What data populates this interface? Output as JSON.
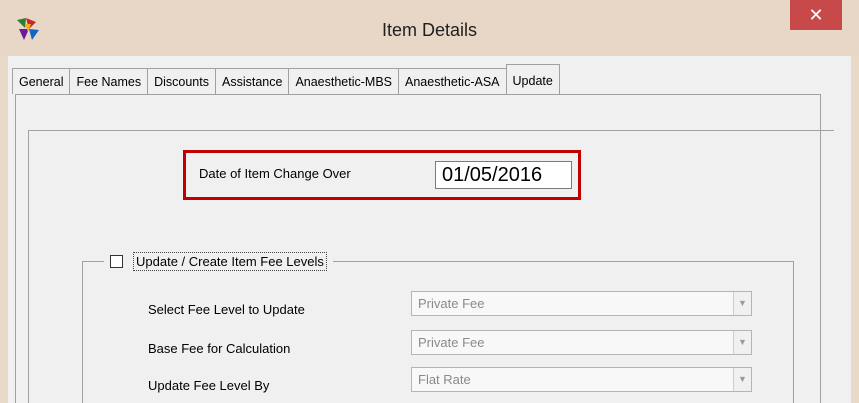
{
  "window": {
    "title": "Item Details",
    "close_label": "✕",
    "accent_colors": {
      "titlebar": "#e8d7c6",
      "close_button": "#c7494a",
      "highlight_border": "#c00000"
    }
  },
  "tabs": [
    {
      "label": "General"
    },
    {
      "label": "Fee Names"
    },
    {
      "label": "Discounts"
    },
    {
      "label": "Assistance"
    },
    {
      "label": "Anaesthetic-MBS"
    },
    {
      "label": "Anaesthetic-ASA"
    },
    {
      "label": "Update",
      "active": true
    }
  ],
  "changeover": {
    "label": "Date of Item Change Over",
    "date": "01/05/2016"
  },
  "fee_levels": {
    "checkbox_label": "Update / Create Item Fee Levels",
    "checked": false,
    "rows": [
      {
        "label": "Select Fee Level to Update",
        "value": "Private Fee"
      },
      {
        "label": "Base Fee for Calculation",
        "value": "Private Fee"
      },
      {
        "label": "Update Fee Level By",
        "value": "Flat Rate"
      }
    ]
  }
}
